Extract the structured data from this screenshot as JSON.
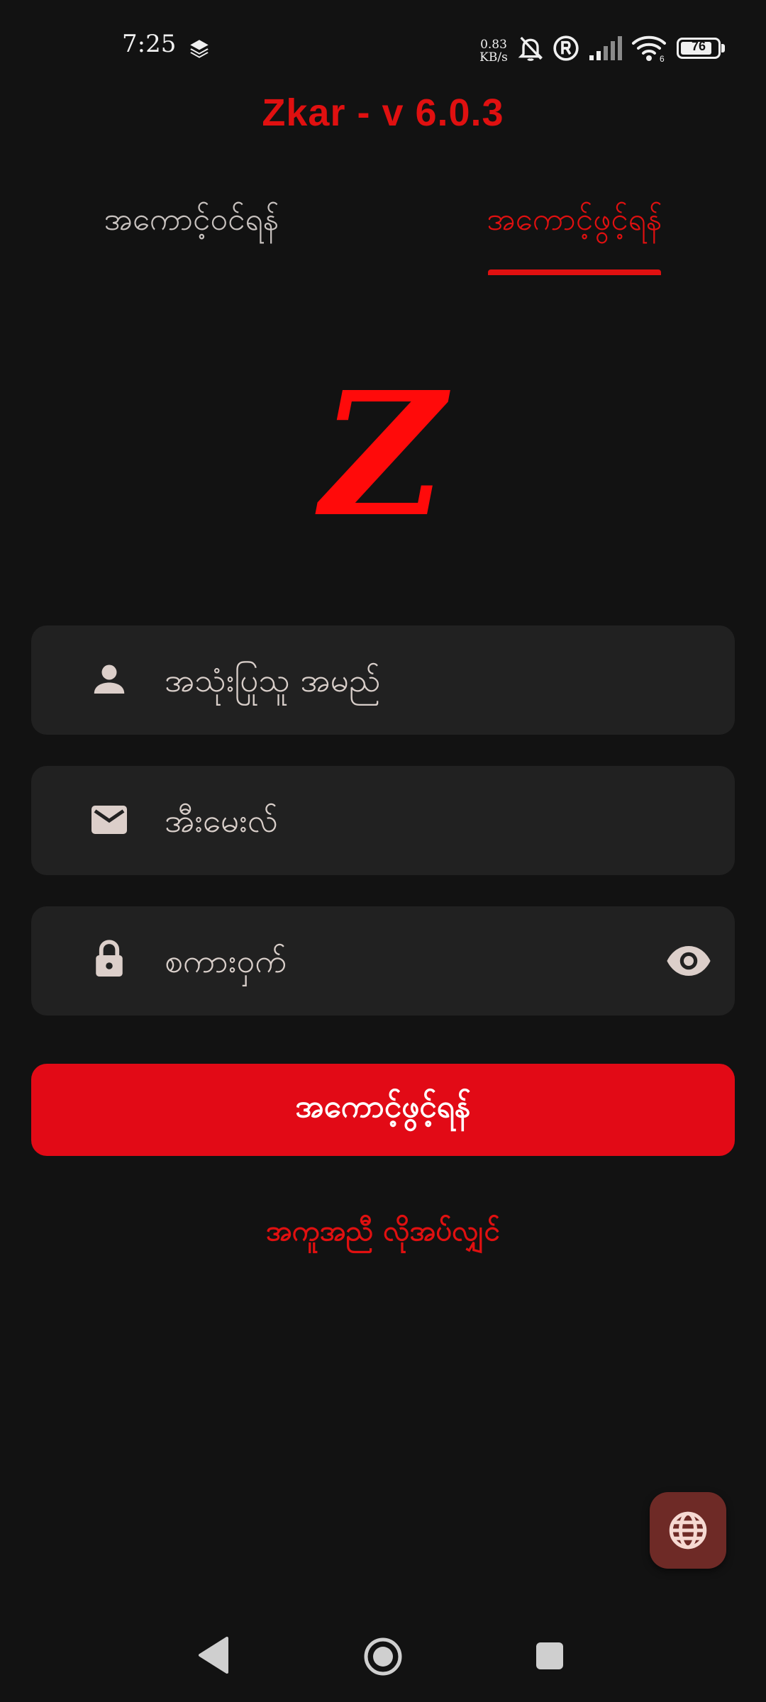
{
  "status_bar": {
    "time": "7:25",
    "net_speed_value": "0.83",
    "net_speed_unit": "KB/s",
    "battery_level": "76",
    "icons": [
      "layers-icon",
      "bell-off-icon",
      "registered-icon",
      "signal-icon",
      "wifi-icon",
      "battery-icon"
    ]
  },
  "app": {
    "title": "Zkar - v 6.0.3",
    "logo_letter": "Z",
    "accent_color": "#e01010"
  },
  "tabs": [
    {
      "label": "အကောင့်ဝင်ရန်",
      "active": false
    },
    {
      "label": "အကောင့်ဖွင့်ရန်",
      "active": true
    }
  ],
  "form": {
    "username_placeholder": "အသုံးပြုသူ အမည်",
    "username_value": "",
    "email_placeholder": "အီးမေးလ်",
    "email_value": "",
    "password_placeholder": "စကားဝှက်",
    "password_value": "",
    "submit_label": "အကောင့်ဖွင့်ရန်",
    "help_label": "အကူအညီ လိုအပ်လျှင်"
  },
  "fab": {
    "icon": "globe-icon"
  },
  "nav_bar": {
    "icons": [
      "back-icon",
      "home-icon",
      "recents-icon"
    ]
  }
}
